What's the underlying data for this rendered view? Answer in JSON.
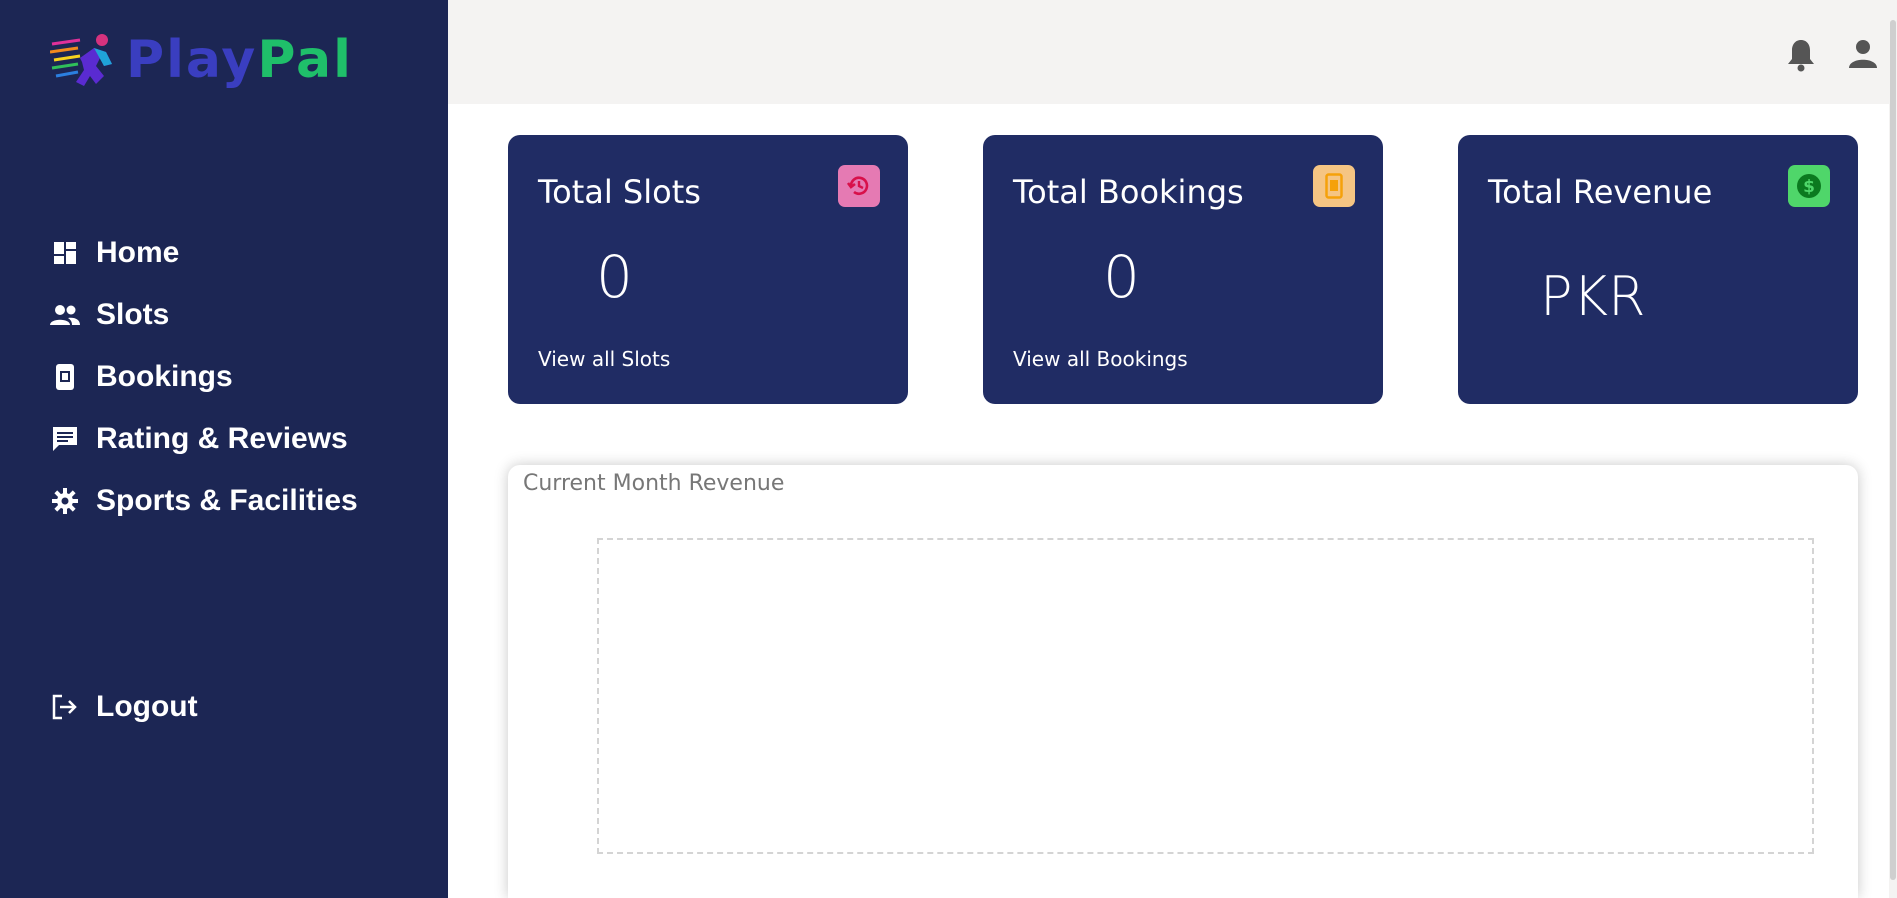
{
  "brand": {
    "name_part1": "Play",
    "name_part2": "Pal",
    "color_play": "#3a3ec0",
    "color_pal": "#1fbf6a"
  },
  "sidebar": {
    "background": "#1c2654",
    "items": [
      {
        "label": "Home",
        "icon": "dashboard-icon"
      },
      {
        "label": "Slots",
        "icon": "people-icon"
      },
      {
        "label": "Bookings",
        "icon": "booking-card-icon"
      },
      {
        "label": "Rating & Reviews",
        "icon": "comment-icon"
      },
      {
        "label": "Sports & Facilities",
        "icon": "gear-icon"
      }
    ],
    "logout": {
      "label": "Logout",
      "icon": "logout-icon"
    }
  },
  "topbar": {
    "icons": [
      "bell-icon",
      "user-icon"
    ]
  },
  "cards": [
    {
      "title": "Total Slots",
      "value": "0",
      "link": "View all Slots",
      "badge_icon": "history-icon",
      "badge_color": "#e57ab3"
    },
    {
      "title": "Total Bookings",
      "value": "0",
      "link": "View all Bookings",
      "badge_icon": "phone-icon",
      "badge_color": "#f5c583"
    },
    {
      "title": "Total Revenue",
      "value": "PKR",
      "link": "",
      "badge_icon": "dollar-icon",
      "badge_color": "#4fd66a"
    }
  ],
  "revenue": {
    "title": "Current Month Revenue"
  }
}
